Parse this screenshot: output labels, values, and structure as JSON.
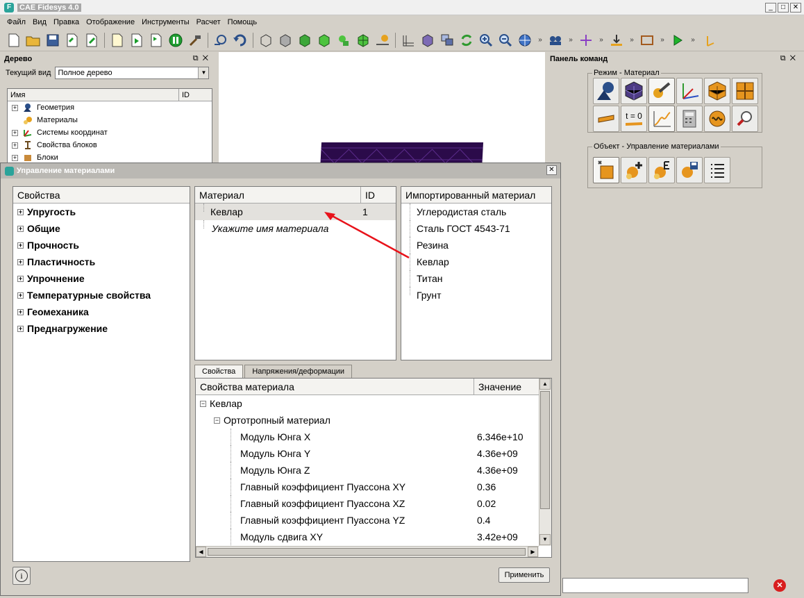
{
  "app": {
    "title": "CAE Fidesys 4.0"
  },
  "menu": [
    "Файл",
    "Вид",
    "Правка",
    "Отображение",
    "Инструменты",
    "Расчет",
    "Помощь"
  ],
  "window_controls": {
    "min": "_",
    "max": "□",
    "close": "✕"
  },
  "tree_panel": {
    "title": "Дерево",
    "current_view_label": "Текущий вид",
    "current_view_value": "Полное дерево",
    "col_name": "Имя",
    "col_id": "ID",
    "items": [
      "Геометрия",
      "Материалы",
      "Системы координат",
      "Свойства блоков",
      "Блоки"
    ]
  },
  "command_panel": {
    "title": "Панель команд",
    "mode_group": "Режим - Материал",
    "object_group": "Объект - Управление материалами",
    "t0_label": "t = 0"
  },
  "dialog": {
    "title": "Управление материалами",
    "properties_header": "Свойства",
    "property_categories": [
      "Упругость",
      "Общие",
      "Прочность",
      "Пластичность",
      "Упрочнение",
      "Температурные свойства",
      "Геомеханика",
      "Преднагружение"
    ],
    "material_col": "Материал",
    "id_col": "ID",
    "materials": [
      {
        "name": "Кевлар",
        "id": "1"
      }
    ],
    "material_placeholder": "Укажите имя материала",
    "imported_header": "Импортированный материал",
    "imported": [
      "Углеродистая сталь",
      "Сталь ГОСТ 4543-71",
      "Резина",
      "Кевлар",
      "Титан",
      "Грунт"
    ],
    "tabs": [
      "Свойства",
      "Напряжения/деформации"
    ],
    "props_col": "Свойства материала",
    "value_col": "Значение",
    "root_material": "Кевлар",
    "model": "Ортотропный материал",
    "props": [
      {
        "name": "Модуль Юнга X",
        "value": "6.346e+10"
      },
      {
        "name": "Модуль Юнга Y",
        "value": "4.36e+09"
      },
      {
        "name": "Модуль Юнга Z",
        "value": "4.36e+09"
      },
      {
        "name": "Главный коэффициент Пуассона XY",
        "value": "0.36"
      },
      {
        "name": "Главный коэффициент Пуассона XZ",
        "value": "0.02"
      },
      {
        "name": "Главный коэффициент Пуассона YZ",
        "value": "0.4"
      },
      {
        "name": "Модуль сдвига XY",
        "value": "3.42e+09"
      }
    ],
    "apply_label": "Применить",
    "info_label": "i"
  },
  "colors": {
    "annotation_arrow": "#e8121a",
    "mesh": "#2b0b4a",
    "accent": "#2aa39a"
  }
}
